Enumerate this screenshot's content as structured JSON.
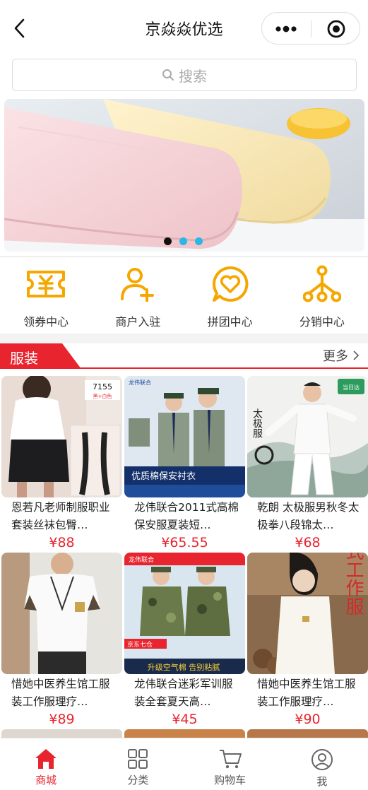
{
  "header": {
    "title": "京焱焱优选"
  },
  "search": {
    "placeholder": "搜索"
  },
  "banner": {
    "dots": 3,
    "active_dot": 1
  },
  "menu": [
    {
      "label": "领券中心",
      "icon": "coupon-icon"
    },
    {
      "label": "商户入驻",
      "icon": "add-user-icon"
    },
    {
      "label": "拼团中心",
      "icon": "heart-chat-icon"
    },
    {
      "label": "分销中心",
      "icon": "share-network-icon"
    }
  ],
  "section": {
    "title": "服装",
    "more": "更多"
  },
  "products": [
    {
      "name": "恩若凡老师制服职业套装丝袜包臀…",
      "price": "¥88",
      "image_text": "7155",
      "image_subtext": "黑+白色"
    },
    {
      "name": "龙伟联合2011式高棉保安服夏装短…",
      "price": "¥65.55",
      "image_text": "优质棉保安衬衣",
      "image_subtext": "龙伟联合"
    },
    {
      "name": "乾朗 太极服男秋冬太极拳八段锦太…",
      "price": "¥68",
      "image_text": "太极服",
      "image_subtext": "当日达"
    },
    {
      "name": "惜她中医养生馆工服装工作服理疗…",
      "price": "¥89",
      "image_text": "",
      "image_subtext": ""
    },
    {
      "name": "龙伟联合迷彩军训服装全套夏天高…",
      "price": "¥45",
      "image_text": "升级空气棉 告别粘腻",
      "image_subtext": "京东七仓"
    },
    {
      "name": "惜她中医养生馆工服装工作服理疗…",
      "price": "¥90",
      "image_text": "中式工作服",
      "image_subtext": ""
    }
  ],
  "tabbar": [
    {
      "label": "商城",
      "icon": "home-icon",
      "active": true
    },
    {
      "label": "分类",
      "icon": "grid-icon",
      "active": false
    },
    {
      "label": "购物车",
      "icon": "cart-icon",
      "active": false
    },
    {
      "label": "我",
      "icon": "user-icon",
      "active": false
    }
  ],
  "colors": {
    "accent": "#e8242e",
    "menu_icon": "#f5a700",
    "dot": "#27b7e8"
  }
}
